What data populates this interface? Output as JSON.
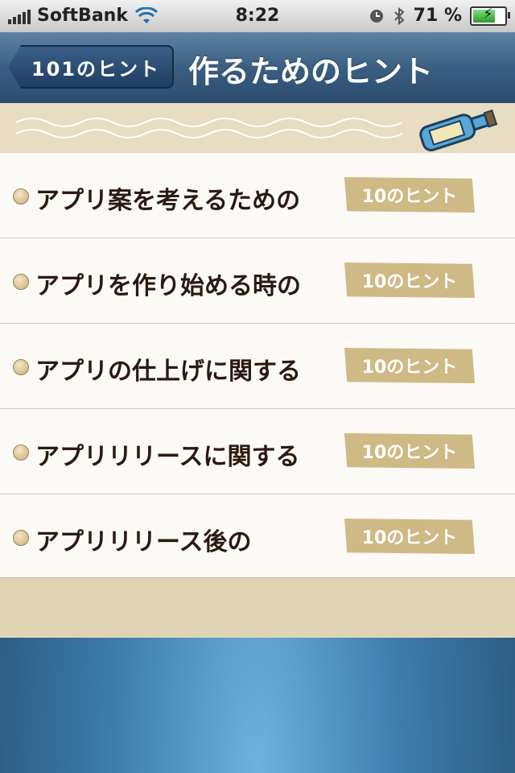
{
  "status_bar": {
    "carrier": "SoftBank",
    "time": "8:22",
    "battery": "71 %",
    "battery_level": 0.71
  },
  "nav": {
    "back_label": "101のヒント",
    "title": "作るためのヒント"
  },
  "list": {
    "items": [
      {
        "label": "アプリ案を考えるための",
        "tag": "10のヒント"
      },
      {
        "label": "アプリを作り始める時の",
        "tag": "10のヒント"
      },
      {
        "label": "アプリの仕上げに関する",
        "tag": "10のヒント"
      },
      {
        "label": "アプリリリースに関する",
        "tag": "10のヒント"
      },
      {
        "label": "アプリリリース後の",
        "tag": "10のヒント"
      }
    ]
  },
  "colors": {
    "nav_gradient_top": "#5f82a3",
    "band": "#e8dcc2",
    "tag": "#cfb985",
    "text": "#2a1a12"
  }
}
